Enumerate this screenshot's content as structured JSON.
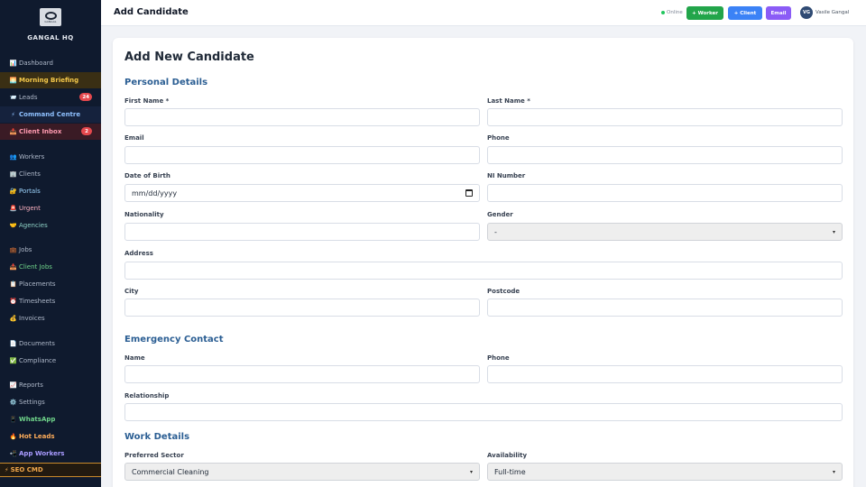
{
  "sidebar": {
    "brand": "GANGAL HQ",
    "logo_text": "GANGAL",
    "items": [
      {
        "icon": "📊",
        "label": "Dashboard"
      },
      {
        "icon": "🌅",
        "label": "Morning Briefing"
      },
      {
        "icon": "📨",
        "label": "Leads",
        "badge": "24"
      },
      {
        "icon": "⚡",
        "label": "Command Centre"
      },
      {
        "icon": "📥",
        "label": "Client Inbox",
        "badge": "2"
      },
      {
        "icon": "👥",
        "label": "Workers"
      },
      {
        "icon": "🏢",
        "label": "Clients"
      },
      {
        "icon": "🔐",
        "label": "Portals"
      },
      {
        "icon": "🚨",
        "label": "Urgent"
      },
      {
        "icon": "🤝",
        "label": "Agencies"
      },
      {
        "icon": "💼",
        "label": "Jobs"
      },
      {
        "icon": "📥",
        "label": "Client Jobs"
      },
      {
        "icon": "📋",
        "label": "Placements"
      },
      {
        "icon": "⏰",
        "label": "Timesheets"
      },
      {
        "icon": "💰",
        "label": "Invoices"
      },
      {
        "icon": "📄",
        "label": "Documents"
      },
      {
        "icon": "✅",
        "label": "Compliance"
      },
      {
        "icon": "📈",
        "label": "Reports"
      },
      {
        "icon": "⚙️",
        "label": "Settings"
      },
      {
        "icon": "📱",
        "label": "WhatsApp"
      },
      {
        "icon": "🔥",
        "label": "Hot Leads"
      },
      {
        "icon": "📲",
        "label": "App Workers"
      },
      {
        "icon": "⚡",
        "label": "SEO CMD"
      }
    ]
  },
  "topbar": {
    "title": "Add Candidate",
    "status": "Online",
    "worker_btn": "+ Worker",
    "client_btn": "+ Client",
    "email_btn": "Email",
    "user_initials": "VG",
    "user_name": "Vasile Gangal"
  },
  "form": {
    "title": "Add New Candidate",
    "personal": {
      "heading": "Personal Details",
      "first_name": "First Name *",
      "last_name": "Last Name *",
      "email": "Email",
      "phone": "Phone",
      "dob": "Date of Birth",
      "dob_value": "mm/dd/yyyy",
      "ni": "NI Number",
      "nationality": "Nationality",
      "gender": "Gender",
      "gender_value": "-",
      "address": "Address",
      "city": "City",
      "postcode": "Postcode"
    },
    "emergency": {
      "heading": "Emergency Contact",
      "name": "Name",
      "phone": "Phone",
      "relationship": "Relationship"
    },
    "work": {
      "heading": "Work Details",
      "sector": "Preferred Sector",
      "sector_value": "Commercial Cleaning",
      "availability": "Availability",
      "availability_value": "Full-time"
    }
  }
}
